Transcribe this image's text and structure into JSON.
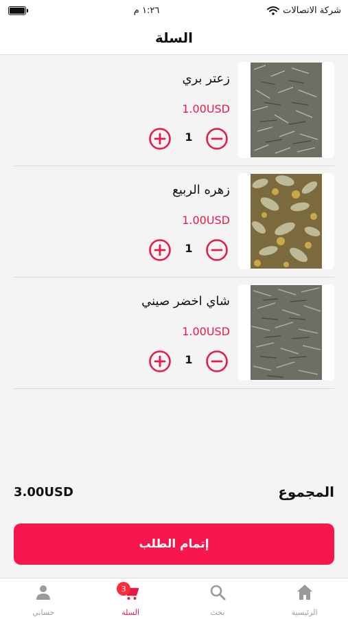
{
  "status_bar": {
    "carrier": "شركة الاتصالات",
    "time": "١:٢٦ م",
    "battery_level": 1.0,
    "icons": [
      "wifi-icon",
      "battery-icon"
    ]
  },
  "header": {
    "title": "السلة"
  },
  "cart": {
    "items": [
      {
        "name": "زعتر بري",
        "price": "1.00USD",
        "quantity": "1",
        "image": "wild-thyme-photo"
      },
      {
        "name": "زهره الربيع",
        "price": "1.00USD",
        "quantity": "1",
        "image": "spring-flower-photo"
      },
      {
        "name": "شاي اخضر صيني",
        "price": "1.00USD",
        "quantity": "1",
        "image": "chinese-green-tea-photo"
      }
    ],
    "total_label": "المجموع",
    "total_value": "3.00USD",
    "checkout_label": "إتمام الطلب"
  },
  "tab_bar": {
    "tabs": [
      {
        "label": "حسابي",
        "icon": "person-icon",
        "active": false
      },
      {
        "label": "السلة",
        "icon": "cart-icon",
        "active": true,
        "badge": "3"
      },
      {
        "label": "بحث",
        "icon": "search-icon",
        "active": false
      },
      {
        "label": "الرئيسية",
        "icon": "home-icon",
        "active": false
      }
    ]
  },
  "colors": {
    "accent": "#f7174d",
    "price": "#e8194a",
    "badge": "#ff2a3a",
    "inactive_tab": "#9a9a9a",
    "background": "#f4f4f4"
  }
}
